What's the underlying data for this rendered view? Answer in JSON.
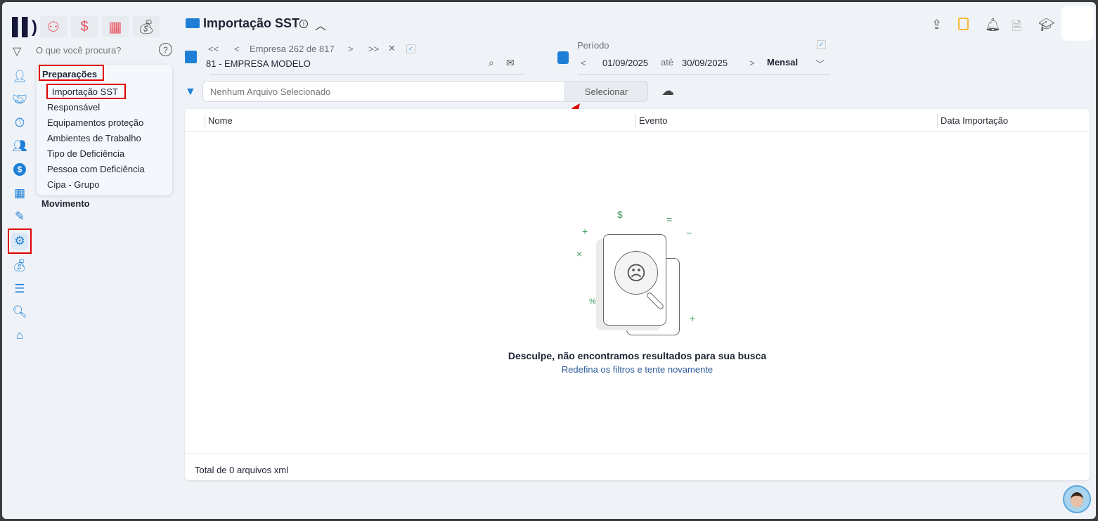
{
  "top_apps": [
    {
      "icon": "people-icon"
    },
    {
      "icon": "dollar-icon"
    },
    {
      "icon": "calculator-icon"
    },
    {
      "icon": "money-bag-icon"
    }
  ],
  "search": {
    "placeholder": "O que você procura?"
  },
  "menu": {
    "section": "Preparações",
    "items": [
      "Importação SST",
      "Responsável",
      "Equipamentos proteção",
      "Ambientes de Trabalho",
      "Tipo de Deficiência",
      "Pessoa com Deficiência",
      "Cipa - Grupo"
    ],
    "next_section": "Movimento"
  },
  "header": {
    "title": "Importação SST"
  },
  "empresa": {
    "nav_label": "Empresa 262 de 817",
    "name": "81 - EMPRESA MODELO"
  },
  "periodo": {
    "label": "Período",
    "from": "01/09/2025",
    "sep": "até",
    "to": "30/09/2025",
    "mode": "Mensal"
  },
  "file": {
    "placeholder": "Nenhum Arquivo Selecionado",
    "button": "Selecionar"
  },
  "table": {
    "columns": [
      "Nome",
      "Evento",
      "Data Importação"
    ],
    "rows": []
  },
  "empty": {
    "title": "Desculpe, não encontramos resultados para sua busca",
    "subtitle": "Redefina os filtros e tente novamente"
  },
  "footer": {
    "total": "Total de 0 arquivos xml"
  },
  "colors": {
    "accent": "#1f7fd6",
    "highlight": "#e00000"
  }
}
